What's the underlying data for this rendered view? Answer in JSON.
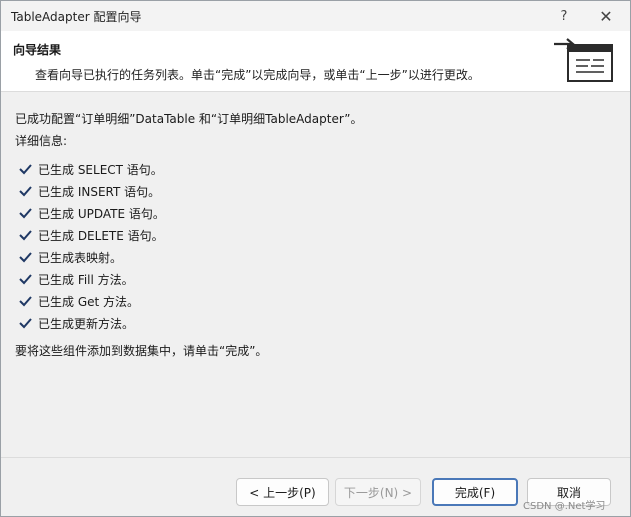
{
  "window": {
    "title": "TableAdapter 配置向导",
    "help_label": "?",
    "close_label": "✕"
  },
  "header": {
    "title": "向导结果",
    "description": "查看向导已执行的任务列表。单击“完成”以完成向导，或单击“上一步”以进行更改。",
    "icon": "wizard-form-icon"
  },
  "content": {
    "summary": "已成功配置“订单明细”DataTable 和“订单明细TableAdapter”。",
    "details_label": "详细信息:",
    "steps": [
      "已生成 SELECT 语句。",
      "已生成 INSERT 语句。",
      "已生成 UPDATE 语句。",
      "已生成 DELETE 语句。",
      "已生成表映射。",
      "已生成 Fill 方法。",
      "已生成 Get 方法。",
      "已生成更新方法。"
    ],
    "footer_note": "要将这些组件添加到数据集中，请单击“完成”。"
  },
  "buttons": {
    "prev": "< 上一步(P)",
    "next": "下一步(N) >",
    "finish": "完成(F)",
    "cancel": "取消"
  },
  "watermark": "CSDN @.Net学习",
  "colors": {
    "check": "#1f3864",
    "accent_border": "#4a78b8",
    "header_bg": "#ffffff",
    "body_bg": "#f0f0f0"
  }
}
